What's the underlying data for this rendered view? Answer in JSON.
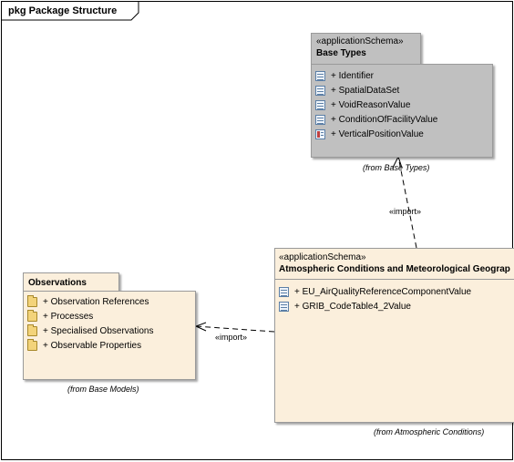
{
  "frame": {
    "title": "pkg Package Structure"
  },
  "packages": {
    "base_types": {
      "stereotype": "«applicationSchema»",
      "name": "Base Types",
      "items": [
        {
          "label": "+ Identifier",
          "icon": "class-icon"
        },
        {
          "label": "+ SpatialDataSet",
          "icon": "class-icon"
        },
        {
          "label": "+ VoidReasonValue",
          "icon": "class-icon"
        },
        {
          "label": "+ ConditionOfFacilityValue",
          "icon": "class-icon"
        },
        {
          "label": "+ VerticalPositionValue",
          "icon": "enumeration-icon"
        }
      ],
      "from": "(from Base Types)",
      "color": "#c0c0c0"
    },
    "atmospheric": {
      "stereotype": "«applicationSchema»",
      "name": "Atmospheric Conditions and Meteorological Geograp",
      "items": [
        {
          "label": "+ EU_AirQualityReferenceComponentValue",
          "icon": "class-icon"
        },
        {
          "label": "+ GRIB_CodeTable4_2Value",
          "icon": "class-icon"
        }
      ],
      "from": "(from Atmospheric Conditions)",
      "color": "#fbefdc"
    },
    "observations": {
      "name": "Observations",
      "items": [
        {
          "label": "+ Observation References",
          "icon": "folder-icon"
        },
        {
          "label": "+ Processes",
          "icon": "folder-icon"
        },
        {
          "label": "+ Specialised Observations",
          "icon": "folder-icon"
        },
        {
          "label": "+ Observable Properties",
          "icon": "folder-icon"
        }
      ],
      "from": "(from Base Models)",
      "color": "#fbefdc"
    }
  },
  "dependencies": [
    {
      "from": "Atmospheric Conditions and Meteorological Geograp",
      "to": "Base Types",
      "label": "«import»"
    },
    {
      "from": "Atmospheric Conditions and Meteorological Geograp",
      "to": "Observations",
      "label": "«import»"
    }
  ]
}
